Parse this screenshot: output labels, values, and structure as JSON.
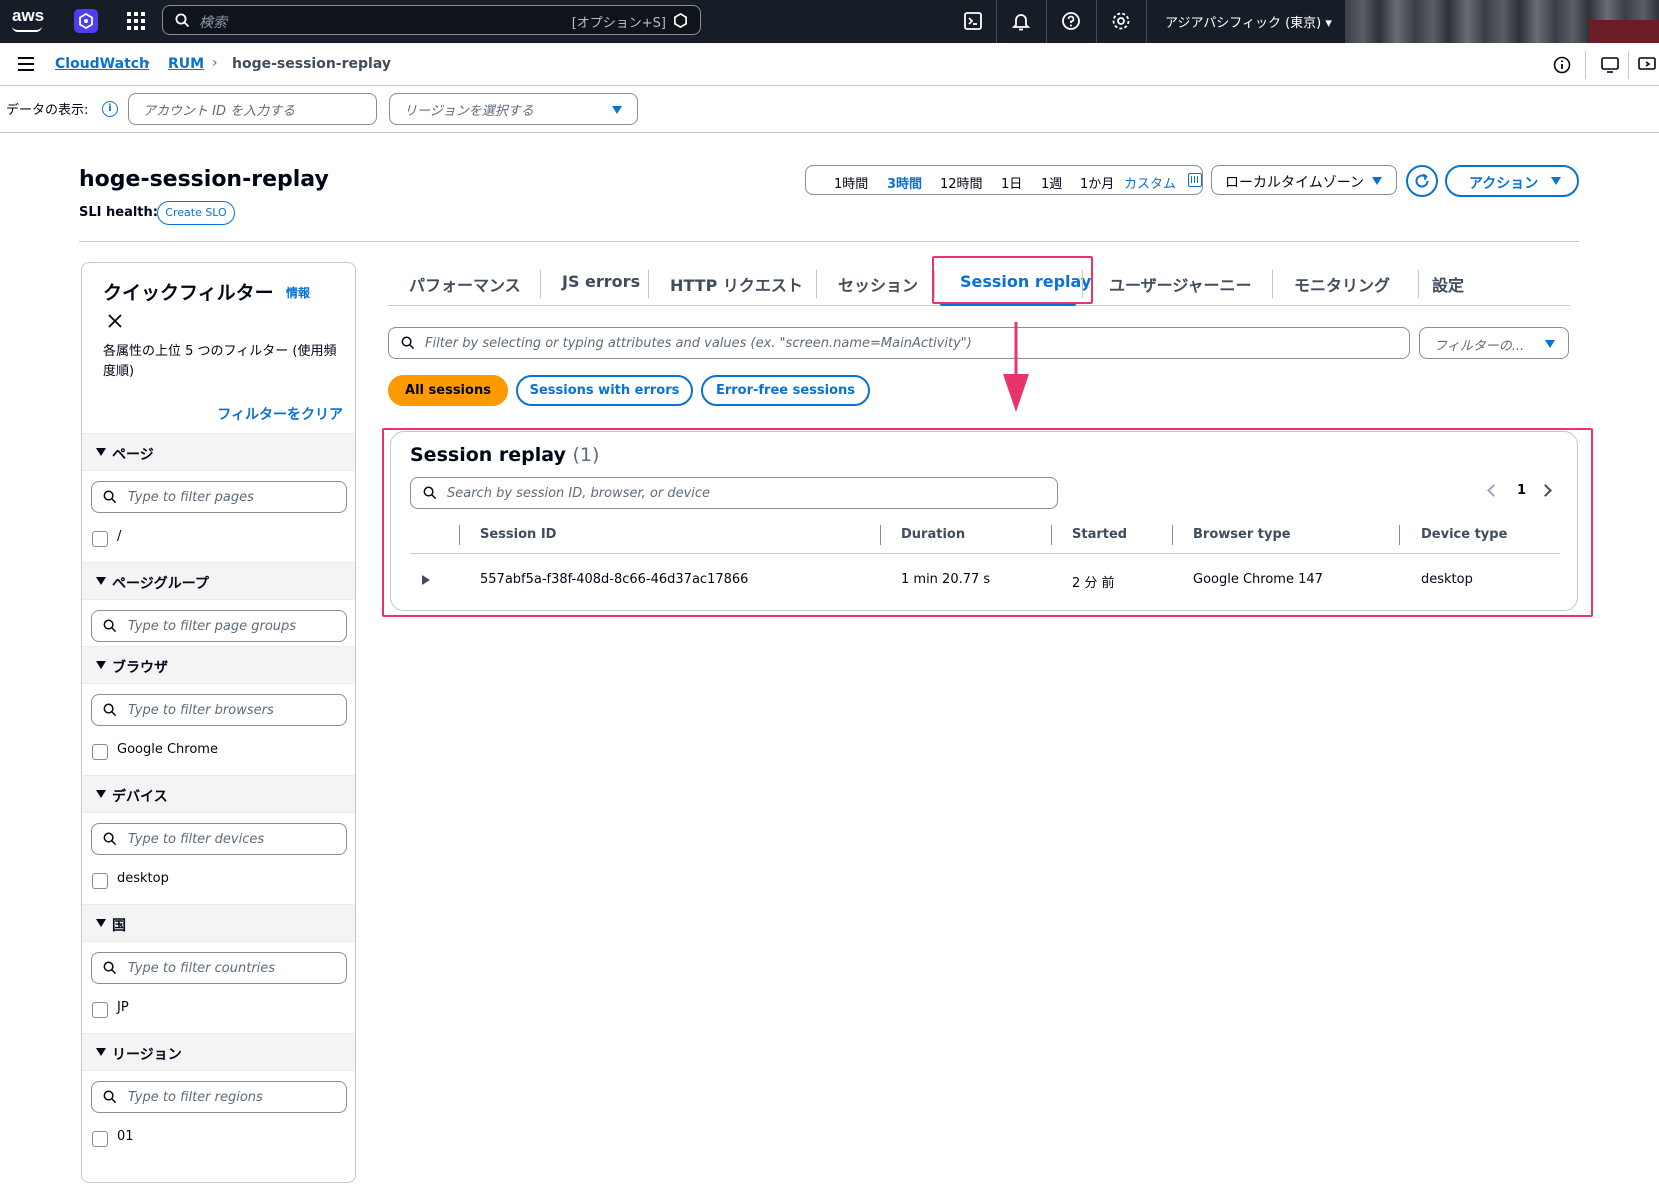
{
  "topbar": {
    "logo_text": "aws",
    "search_placeholder": "検索",
    "search_shortcut": "[オプション+S]",
    "region": "アジアパシフィック (東京)"
  },
  "breadcrumb": {
    "items": [
      "CloudWatch",
      "RUM",
      "hoge-session-replay"
    ]
  },
  "account_bar": {
    "label": "データの表示:",
    "account_placeholder": "アカウント ID を入力する",
    "region_placeholder": "リージョンを選択する"
  },
  "header": {
    "title": "hoge-session-replay",
    "sli_label": "SLI health:",
    "create_slo": "Create SLO",
    "time_options": [
      "1時間",
      "3時間",
      "12時間",
      "1日",
      "1週",
      "1か月",
      "カスタム"
    ],
    "active_time": "3時間",
    "timezone": "ローカルタイムゾーン",
    "action_label": "アクション"
  },
  "sidebar": {
    "title": "クイックフィルター",
    "info": "情報",
    "description": "各属性の上位 5 つのフィルター (使用頻度順)",
    "clear": "フィルターをクリア",
    "sections": [
      {
        "label": "ページ",
        "placeholder": "Type to filter pages",
        "option": "/"
      },
      {
        "label": "ページグループ",
        "placeholder": "Type to filter page groups",
        "option": ""
      },
      {
        "label": "ブラウザ",
        "placeholder": "Type to filter browsers",
        "option": "Google Chrome"
      },
      {
        "label": "デバイス",
        "placeholder": "Type to filter devices",
        "option": "desktop"
      },
      {
        "label": "国",
        "placeholder": "Type to filter countries",
        "option": "JP"
      },
      {
        "label": "リージョン",
        "placeholder": "Type to filter regions",
        "option": "01"
      }
    ]
  },
  "tabs": [
    "パフォーマンス",
    "JS errors",
    "HTTP リクエスト",
    "セッション",
    "Session replay",
    "ユーザージャーニー",
    "モニタリング",
    "設定"
  ],
  "active_tab": "Session replay",
  "filters": {
    "property_placeholder": "Filter by selecting or typing attributes and values (ex. \"screen.name=MainActivity\")",
    "select_placeholder": "フィルターの...",
    "segments": [
      "All sessions",
      "Sessions with errors",
      "Error-free sessions"
    ]
  },
  "panel": {
    "title": "Session replay",
    "count": "(1)",
    "search_placeholder": "Search by session ID, browser, or device",
    "page": "1",
    "columns": [
      "Session ID",
      "Duration",
      "Started",
      "Browser type",
      "Device type"
    ],
    "rows": [
      {
        "session_id": "557abf5a-f38f-408d-8c66-46d37ac17866",
        "duration": "1 min 20.77 s",
        "started": "2 分 前",
        "browser": "Google Chrome 147",
        "device": "desktop"
      }
    ]
  },
  "colors": {
    "topbar_bg": "#161d26",
    "link_blue": "#0972d3",
    "primary_orange": "#ff9900",
    "annotation_pink": "#e8336d"
  }
}
